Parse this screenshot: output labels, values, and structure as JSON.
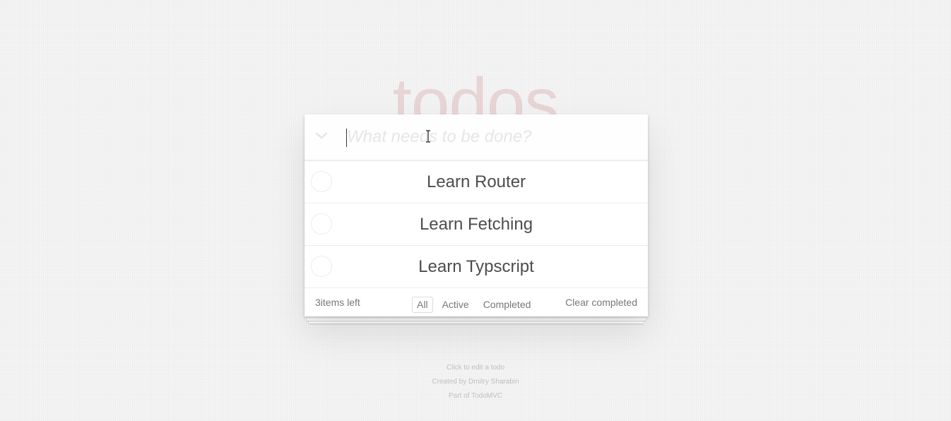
{
  "app": {
    "title": "todos"
  },
  "header": {
    "toggle_all_icon": "chevron-down-icon",
    "new_todo_placeholder": "What needs to be done?",
    "new_todo_value": ""
  },
  "todos": [
    {
      "label": "Learn Router",
      "completed": false
    },
    {
      "label": "Learn Fetching",
      "completed": false
    },
    {
      "label": "Learn Typscript",
      "completed": false
    }
  ],
  "footer": {
    "count_text": "3items left",
    "filters": [
      {
        "label": "All",
        "selected": true
      },
      {
        "label": "Active",
        "selected": false
      },
      {
        "label": "Completed",
        "selected": false
      }
    ],
    "clear_completed_label": "Clear completed"
  },
  "info": {
    "line1": "Click to edit a todo",
    "line2": "Created by Dmitry Sharabin",
    "line3": "Part of TodoMVC"
  },
  "colors": {
    "title": "#af2f2f",
    "text": "#4d4d4d",
    "muted": "#777777",
    "placeholder": "#e6e6e6"
  }
}
